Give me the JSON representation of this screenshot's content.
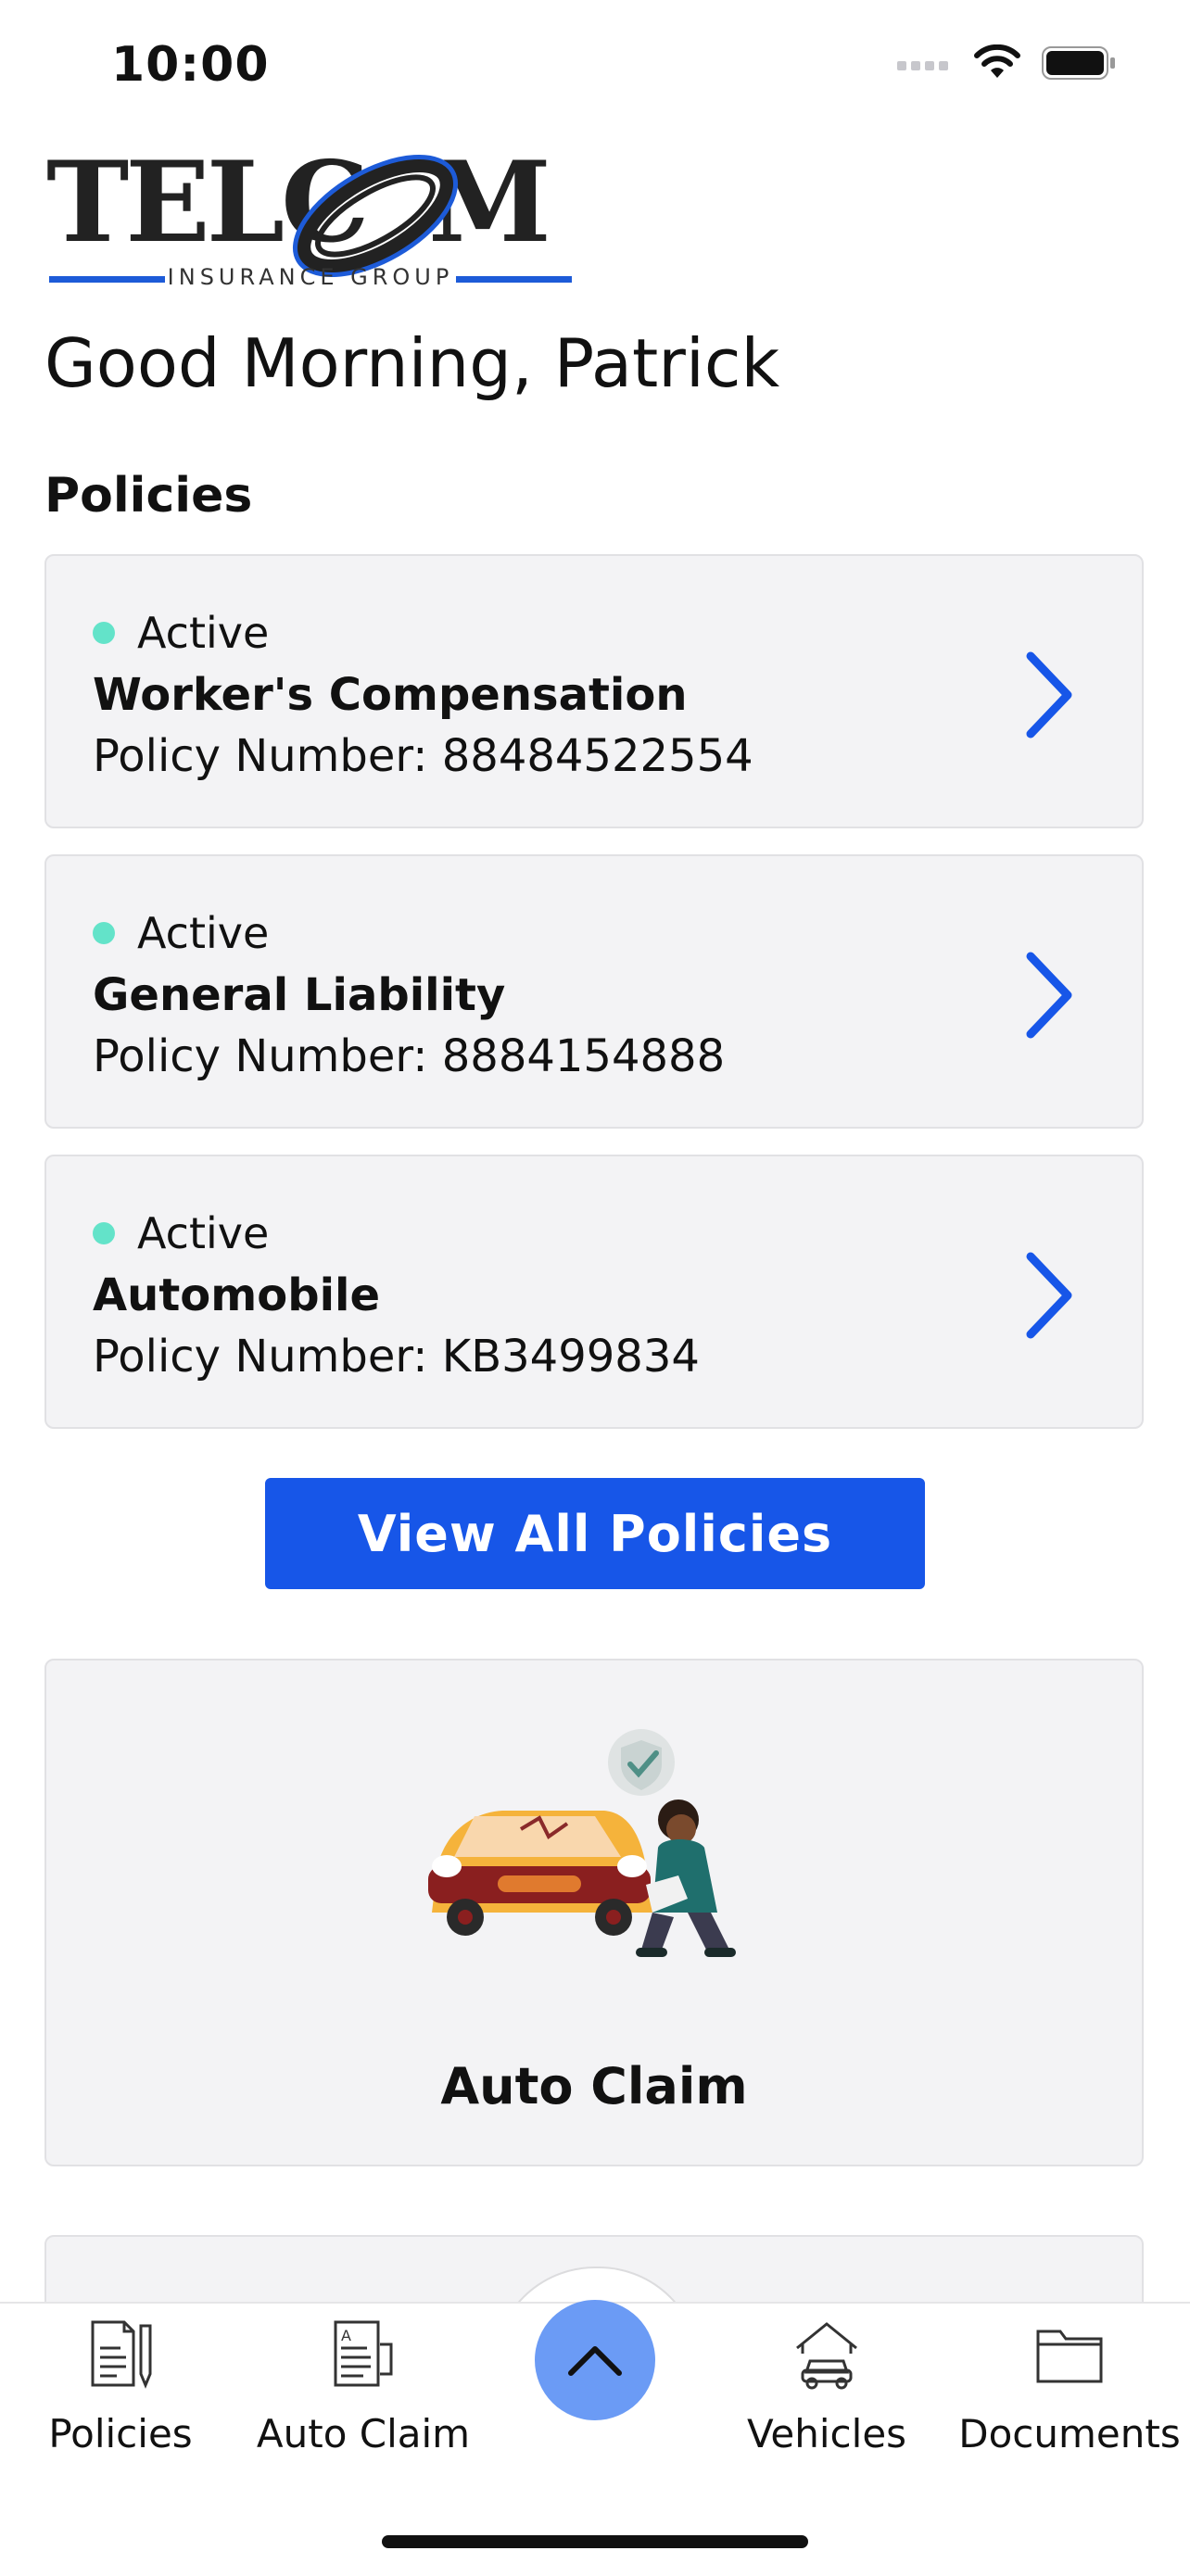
{
  "status_bar": {
    "time": "10:00"
  },
  "logo": {
    "text": "TELCOM",
    "subtext": "INSURANCE GROUP"
  },
  "greeting": "Good Morning, Patrick",
  "policies_section": {
    "title": "Policies"
  },
  "policies": [
    {
      "status": "Active",
      "name": "Worker's Compensation",
      "number": "Policy Number: 88484522554"
    },
    {
      "status": "Active",
      "name": "General Liability",
      "number": "Policy Number: 8884154888"
    },
    {
      "status": "Active",
      "name": "Automobile",
      "number": "Policy Number: KB3499834"
    }
  ],
  "view_all_label": "View All Policies",
  "auto_claim_card": {
    "label": "Auto Claim"
  },
  "tab_bar": {
    "items": [
      {
        "label": "Policies",
        "icon": "policies-icon"
      },
      {
        "label": "Auto Claim",
        "icon": "auto-claim-icon"
      },
      {
        "label": "Vehicles",
        "icon": "vehicles-icon"
      },
      {
        "label": "Documents",
        "icon": "documents-icon"
      }
    ],
    "center_icon": "chevron-up-icon"
  },
  "colors": {
    "accent": "#1756e8",
    "status_active": "#63e3c9",
    "center_button": "#6b9bf5"
  }
}
